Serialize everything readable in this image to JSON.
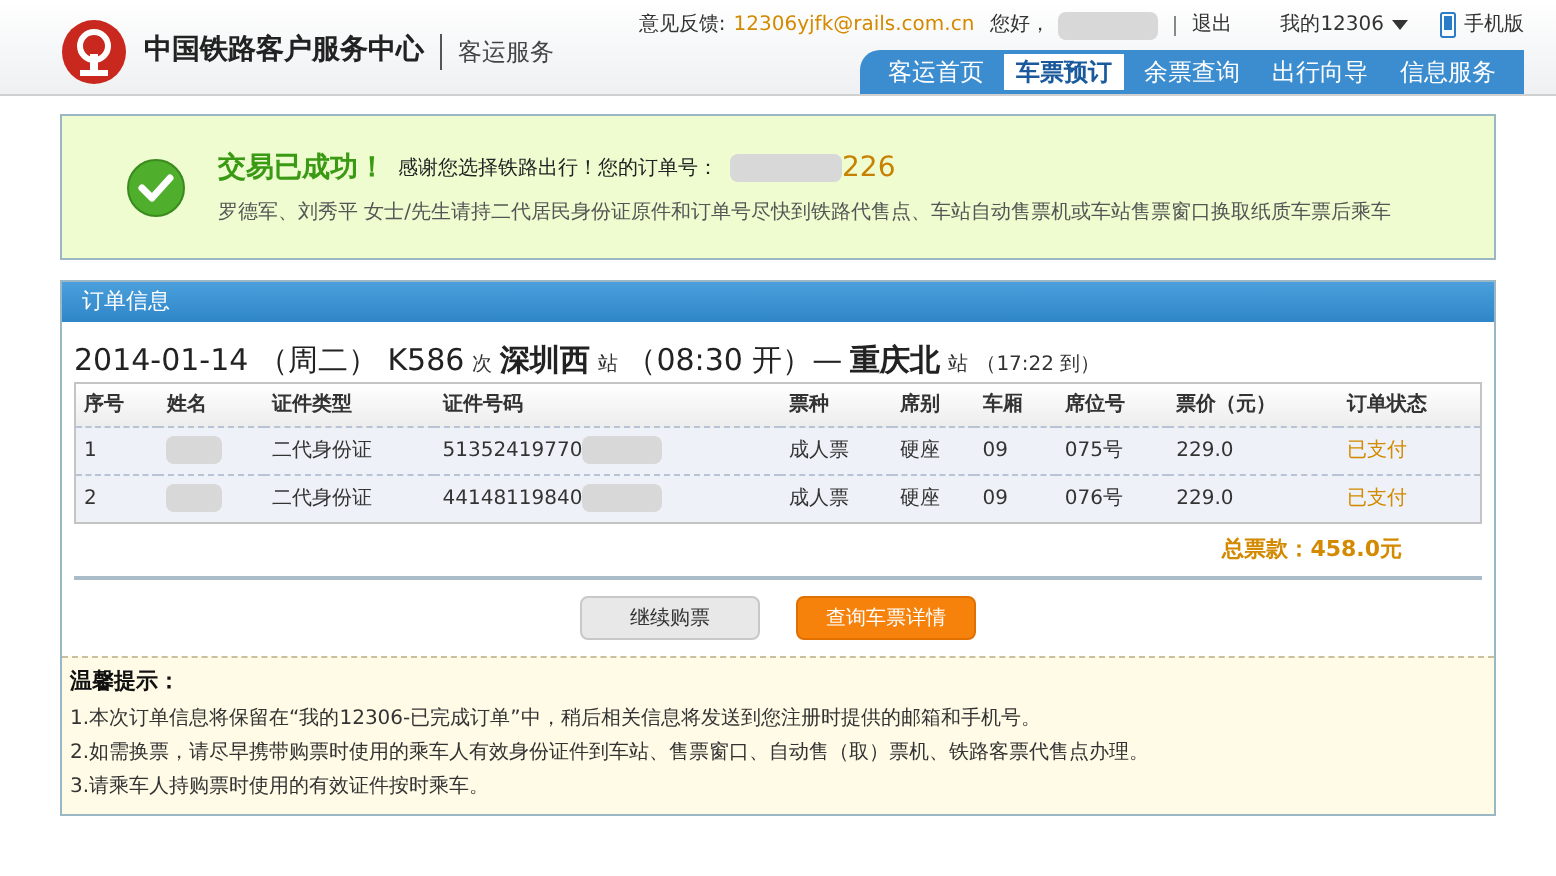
{
  "header": {
    "logo_title": "中国铁路客户服务中心",
    "logo_subtitle": "客运服务",
    "feedback_label": "意见反馈:",
    "feedback_email": "12306yjfk@rails.com.cn",
    "greeting": "您好，",
    "logout": "退出",
    "my_account": "我的12306",
    "mobile": "手机版"
  },
  "nav": [
    {
      "label": "客运首页",
      "selected": false
    },
    {
      "label": "车票预订",
      "selected": true
    },
    {
      "label": "余票查询",
      "selected": false
    },
    {
      "label": "出行向导",
      "selected": false
    },
    {
      "label": "信息服务",
      "selected": false
    }
  ],
  "success": {
    "title": "交易已成功！",
    "thanks": "感谢您选择铁路出行！您的订单号：",
    "order_no_tail": "226",
    "message": "罗德军、刘秀平 女士/先生请持二代居民身份证原件和订单号尽快到铁路代售点、车站自动售票机或车站售票窗口换取纸质车票后乘车"
  },
  "order": {
    "panel_title": "订单信息",
    "trip": [
      {
        "text": "2014-01-14 （周二） K586",
        "kind": "big"
      },
      {
        "text": "次",
        "kind": "small"
      },
      {
        "text": "深圳西",
        "kind": "bold"
      },
      {
        "text": "站",
        "kind": "small"
      },
      {
        "text": "（08:30 开）—",
        "kind": "big"
      },
      {
        "text": "重庆北",
        "kind": "bold"
      },
      {
        "text": "站",
        "kind": "small"
      },
      {
        "text": "（17:22 到）",
        "kind": "small"
      }
    ],
    "columns": [
      "序号",
      "姓名",
      "证件类型",
      "证件号码",
      "票种",
      "席别",
      "车厢",
      "席位号",
      "票价（元）",
      "订单状态"
    ],
    "rows": [
      {
        "no": "1",
        "id_type": "二代身份证",
        "id_no": "51352419770",
        "ticket_type": "成人票",
        "seat_class": "硬座",
        "car": "09",
        "seat": "075号",
        "price": "229.0",
        "status": "已支付"
      },
      {
        "no": "2",
        "id_type": "二代身份证",
        "id_no": "44148119840",
        "ticket_type": "成人票",
        "seat_class": "硬座",
        "car": "09",
        "seat": "076号",
        "price": "229.0",
        "status": "已支付"
      }
    ],
    "total": "总票款：458.0元",
    "buttons": [
      {
        "label": "继续购票",
        "kind": "secondary"
      },
      {
        "label": "查询车票详情",
        "kind": "primary"
      }
    ]
  },
  "tips": {
    "title": "温馨提示：",
    "items": [
      "1.本次订单信息将保留在“我的12306-已完成订单”中，稍后相关信息将发送到您注册时提供的邮箱和手机号。",
      "2.如需换票，请尽早携带购票时使用的乘车人有效身份证件到车站、售票窗口、自动售（取）票机、铁路客票代售点办理。",
      "3.请乘车人持购票时使用的有效证件按时乘车。"
    ]
  }
}
